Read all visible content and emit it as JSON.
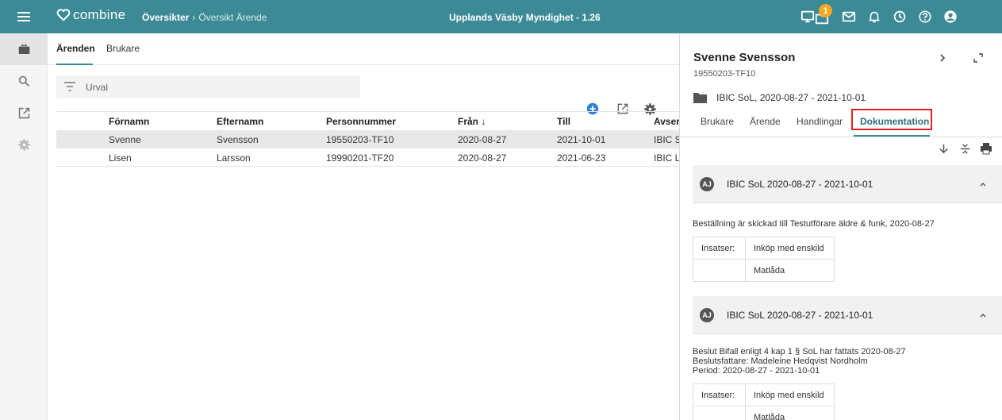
{
  "app": {
    "logo_text": "combine",
    "breadcrumb": [
      "Översikter",
      "Översikt Ärende"
    ],
    "breadcrumb_sep": "›",
    "title": "Upplands Väsby Myndighet - 1.26",
    "notification_count": "1",
    "icons": [
      "monitor-icon",
      "folder-notification-icon",
      "mail-icon",
      "bell-icon",
      "clock-icon",
      "help-icon",
      "account-icon"
    ]
  },
  "rail": {
    "items": [
      "briefcase-icon",
      "search-icon",
      "open-external-icon",
      "gear-icon"
    ]
  },
  "main": {
    "tabs": [
      "Ärenden",
      "Brukare"
    ],
    "filter_placeholder": "Urval",
    "columns": [
      "Förnamn",
      "Efternamn",
      "Personnummer",
      "Från ↓",
      "Till",
      "Avser"
    ],
    "rows": [
      [
        "Svenne",
        "Svensson",
        "19550203-TF10",
        "2020-08-27",
        "2021-10-01",
        "IBIC S"
      ],
      [
        "Lisen",
        "Larsson",
        "19990201-TF20",
        "2020-08-27",
        "2021-06-23",
        "IBIC L"
      ]
    ]
  },
  "panel": {
    "name": "Svenne Svensson",
    "pnr": "19550203-TF10",
    "case": "IBIC SoL, 2020-08-27 - 2021-10-01",
    "tabs": [
      "Brukare",
      "Ärende",
      "Handlingar",
      "Dokumentation"
    ],
    "cards": [
      {
        "badge": "AJ",
        "title": "IBIC SoL 2020-08-27 - 2021-10-01",
        "lines": [
          "Beställning är skickad till Testutförare äldre & funk, 2020-08-27"
        ],
        "insatser_label": "Insatser:",
        "insatser": [
          "Inköp med enskild",
          "Matlåda"
        ]
      },
      {
        "badge": "AJ",
        "title": "IBIC SoL 2020-08-27 - 2021-10-01",
        "lines": [
          "Beslut Bifall enligt 4 kap 1 § SoL har fattats 2020-08-27",
          "Beslutsfattare: Madeleine Hedqvist Nordholm",
          "Period: 2020-08-27 - 2021-10-01"
        ],
        "insatser_label": "Insatser:",
        "insatser": [
          "Inköp med enskild",
          "Matlåda"
        ]
      }
    ]
  },
  "colors": {
    "primary": "#3c8a96",
    "badge": "#f5a623",
    "highlight": "#e02020"
  }
}
